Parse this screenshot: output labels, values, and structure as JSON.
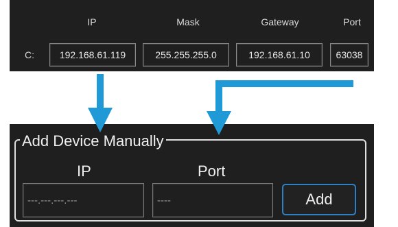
{
  "network": {
    "headers": {
      "ip": "IP",
      "mask": "Mask",
      "gateway": "Gateway",
      "port": "Port"
    },
    "row_label": "C:",
    "ip_value": "192.168.61.119",
    "mask_value": "255.255.255.0",
    "gateway_value": "192.168.61.10",
    "port_value": "63038"
  },
  "add_device": {
    "title": "Add Device Manually",
    "ip_label": "IP",
    "port_label": "Port",
    "ip_placeholder": "---.---.---.---",
    "port_placeholder": "----",
    "add_button_label": "Add"
  },
  "colors": {
    "panel_background": "#1f1f1f",
    "arrow": "#1f9ad6",
    "button_border": "#2f7fc3"
  },
  "icons": [
    "arrow-down-icon",
    "arrow-bend-down-icon"
  ]
}
